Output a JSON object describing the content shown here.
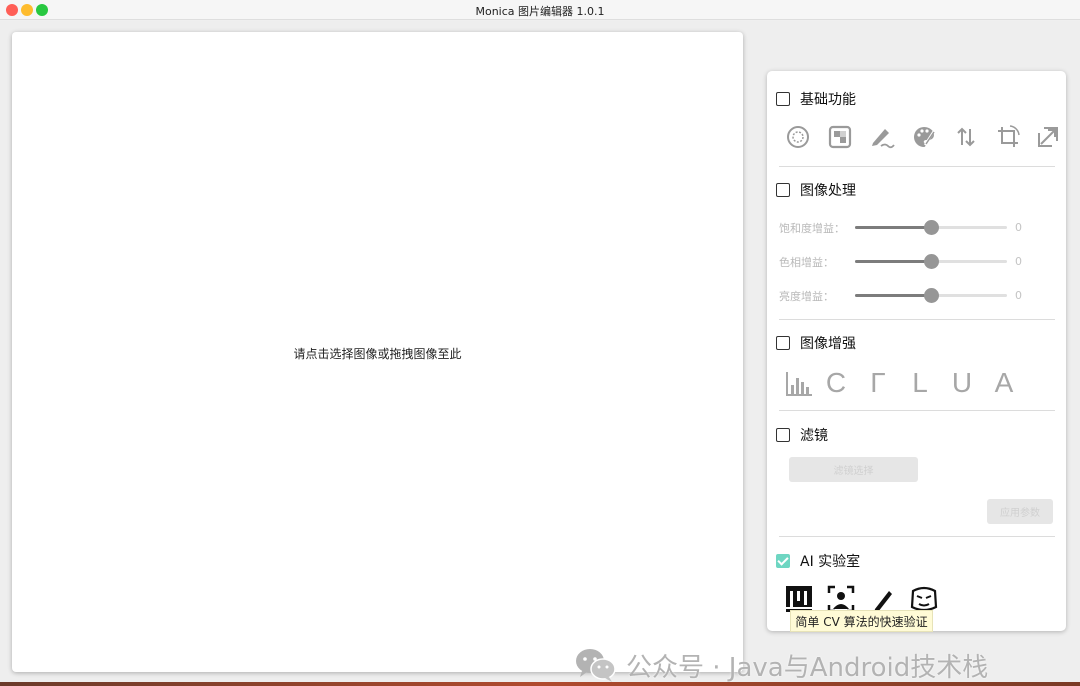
{
  "window": {
    "title": "Monica 图片编辑器 1.0.1"
  },
  "canvas": {
    "hint": "请点击选择图像或拖拽图像至此"
  },
  "panel": {
    "basic": {
      "title": "基础功能",
      "checked": false,
      "icons": [
        "color-picker-icon",
        "mosaic-icon",
        "doodle-pen-icon",
        "palette-icon",
        "flip-icon",
        "crop-icon",
        "resize-icon"
      ]
    },
    "processing": {
      "title": "图像处理",
      "checked": false,
      "sliders": [
        {
          "label": "饱和度增益：",
          "value": "0",
          "position": 0.5
        },
        {
          "label": "色相增益：",
          "value": "0",
          "position": 0.5
        },
        {
          "label": "亮度增益：",
          "value": "0",
          "position": 0.5
        }
      ]
    },
    "enhance": {
      "title": "图像增强",
      "checked": false,
      "buttons": [
        "C",
        "Γ",
        "L",
        "U",
        "A"
      ]
    },
    "filter": {
      "title": "滤镜",
      "checked": false,
      "select_label": "滤镜选择",
      "apply_label": "应用参数"
    },
    "ai": {
      "title": "AI 实验室",
      "checked": true,
      "icons": [
        "sketch-drawing-icon",
        "face-detect-icon",
        "pencil-icon",
        "anime-icon"
      ],
      "tooltip": "简单 CV 算法的快速验证"
    }
  },
  "watermark": {
    "text": "公众号 · Java与Android技术栈"
  },
  "colors": {
    "accent": "#6ed6c2",
    "icon_gray": "#a7a7a7"
  }
}
